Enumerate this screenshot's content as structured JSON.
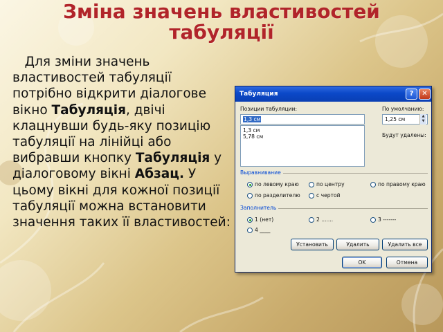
{
  "slide": {
    "title_line1": "Зміна значень властивостей",
    "title_line2": "табуляції",
    "para": {
      "t1": "Для зміни значень властивостей табуляції потрібно відкрити діалогове вікно ",
      "b1": "Табуляція",
      "t2": ", двічі клацнувши будь-яку позицію табуляції на лінійці або вибравши кнопку ",
      "b2": "Табуляція",
      "t3": " у діалоговому вікні ",
      "b3": "Абзац.",
      "t4": " У цьому вікні для кожної позиції табуляції можна встановити значення таких її властивостей:"
    }
  },
  "dialog": {
    "title": "Табуляция",
    "help_glyph": "?",
    "close_glyph": "✕",
    "tab_positions_label": "Позиции табуляции:",
    "tab_position_value": "1,3 см",
    "tab_positions_list": [
      "1,3 см",
      "5,78 см"
    ],
    "default_label": "По умолчанию:",
    "default_value": "1,25 см",
    "to_be_cleared_label": "Будут удалены:",
    "alignment": {
      "title": "Выравнивание",
      "options": [
        "по левому краю",
        "по центру",
        "по правому краю",
        "по разделителю",
        "с чертой"
      ],
      "selected_index": 0
    },
    "leader": {
      "title": "Заполнитель",
      "options": [
        "1 (нет)",
        "2 .......",
        "3 -------",
        "4 ____"
      ],
      "selected_index": 0
    },
    "buttons": {
      "set": "Установить",
      "clear": "Удалить",
      "clear_all": "Удалить все",
      "ok": "OK",
      "cancel": "Отмена"
    },
    "colors": {
      "titlebar": "#0b48c8",
      "group_title": "#0046d5",
      "dialog_bg": "#ece9d8"
    }
  }
}
